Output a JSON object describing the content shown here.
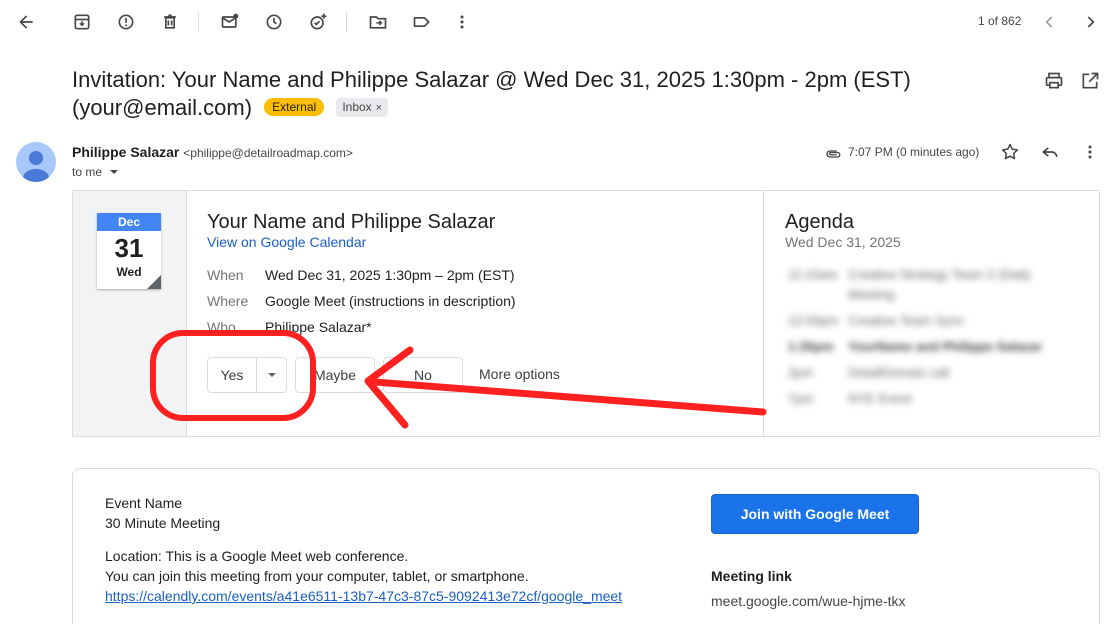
{
  "toolbar": {
    "pager": "1 of 862",
    "icons": [
      "back-arrow-icon",
      "archive-icon",
      "report-spam-icon",
      "delete-icon",
      "mark-unread-icon",
      "snooze-icon",
      "add-task-icon",
      "move-to-icon",
      "label-icon",
      "more-vert-icon",
      "chevron-left-icon",
      "chevron-right-icon"
    ]
  },
  "subject": {
    "text": "Invitation: Your Name and Philippe Salazar @ Wed Dec 31, 2025 1:30pm - 2pm (EST) (your@email.com)",
    "chip_external": "External",
    "chip_inbox": "Inbox",
    "chip_remove": "×"
  },
  "sender": {
    "name": "Philippe Salazar",
    "email": "<philippe@detailroadmap.com>",
    "to": "to me",
    "time": "7:07 PM (0 minutes ago)"
  },
  "invite": {
    "cal_month": "Dec",
    "cal_day": "31",
    "cal_dow": "Wed",
    "title": "Your Name and Philippe Salazar",
    "view_link": "View on Google Calendar",
    "when_label": "When",
    "when_value": "Wed Dec 31, 2025 1:30pm – 2pm (EST)",
    "where_label": "Where",
    "where_value": "Google Meet (instructions in description)",
    "who_label": "Who",
    "who_value": "Philippe Salazar*",
    "rsvp_yes": "Yes",
    "rsvp_maybe": "Maybe",
    "rsvp_no": "No",
    "more_options": "More options"
  },
  "agenda": {
    "title": "Agenda",
    "date": "Wed Dec 31, 2025",
    "rows": [
      {
        "time": "11:15am",
        "text": "Creative Strategy Team 2 (Daily"
      },
      {
        "time": "",
        "text": "Meeting"
      },
      {
        "time": "12:00pm",
        "text": "Creative Team Sync"
      },
      {
        "time": "1:30pm",
        "text": "YourName and Philippe Salazar"
      },
      {
        "time": "2pm",
        "text": "DetailDomain call"
      },
      {
        "time": "7pm",
        "text": "NYE Event"
      }
    ]
  },
  "details": {
    "event_name_label": "Event Name",
    "event_name": "30 Minute Meeting",
    "location_line": "Location: This is a Google Meet web conference.",
    "join_line": "You can join this meeting from your computer, tablet, or smartphone.",
    "url": "https://calendly.com/events/a41e6511-13b7-47c3-87c5-9092413e72cf/google_meet",
    "meet_button": "Join with Google Meet",
    "meeting_link_label": "Meeting link",
    "meeting_link": "meet.google.com/wue-hjme-tkx"
  },
  "colors": {
    "accent": "#1a73e8",
    "external_chip": "#fbbc04",
    "annotation": "#ff2020"
  }
}
